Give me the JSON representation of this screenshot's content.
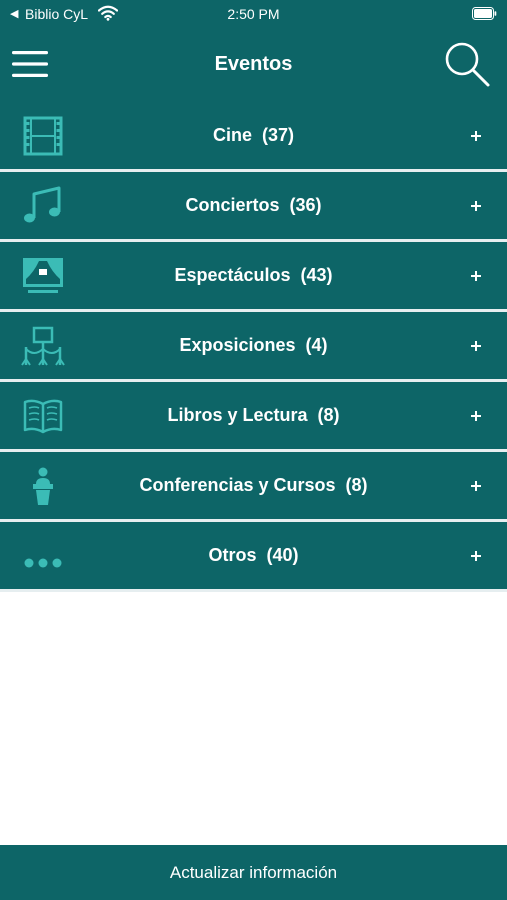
{
  "status_bar": {
    "back_arrow": "◀",
    "carrier": "Biblio CyL",
    "time": "2:50 PM",
    "wifi_icon": "wifi-icon",
    "battery_icon": "battery-icon"
  },
  "nav": {
    "title": "Eventos",
    "menu_icon": "hamburger-menu-icon",
    "search_icon": "search-icon"
  },
  "colors": {
    "primary": "#0d6567",
    "icon_accent": "#3bbcb6",
    "divider": "#e6eef0",
    "text": "#ffffff"
  },
  "categories": [
    {
      "label": "Cine  (37)",
      "icon": "film-strip-icon",
      "expand": "+"
    },
    {
      "label": "Conciertos  (36)",
      "icon": "music-note-icon",
      "expand": "+"
    },
    {
      "label": "Espectáculos  (43)",
      "icon": "theater-stage-icon",
      "expand": "+"
    },
    {
      "label": "Exposiciones  (4)",
      "icon": "exhibition-easel-icon",
      "expand": "+"
    },
    {
      "label": "Libros y Lectura  (8)",
      "icon": "open-book-icon",
      "expand": "+"
    },
    {
      "label": "Conferencias y Cursos  (8)",
      "icon": "podium-speaker-icon",
      "expand": "+"
    },
    {
      "label": "Otros  (40)",
      "icon": "more-dots-icon",
      "expand": "+"
    }
  ],
  "footer": {
    "update_label": "Actualizar información"
  }
}
